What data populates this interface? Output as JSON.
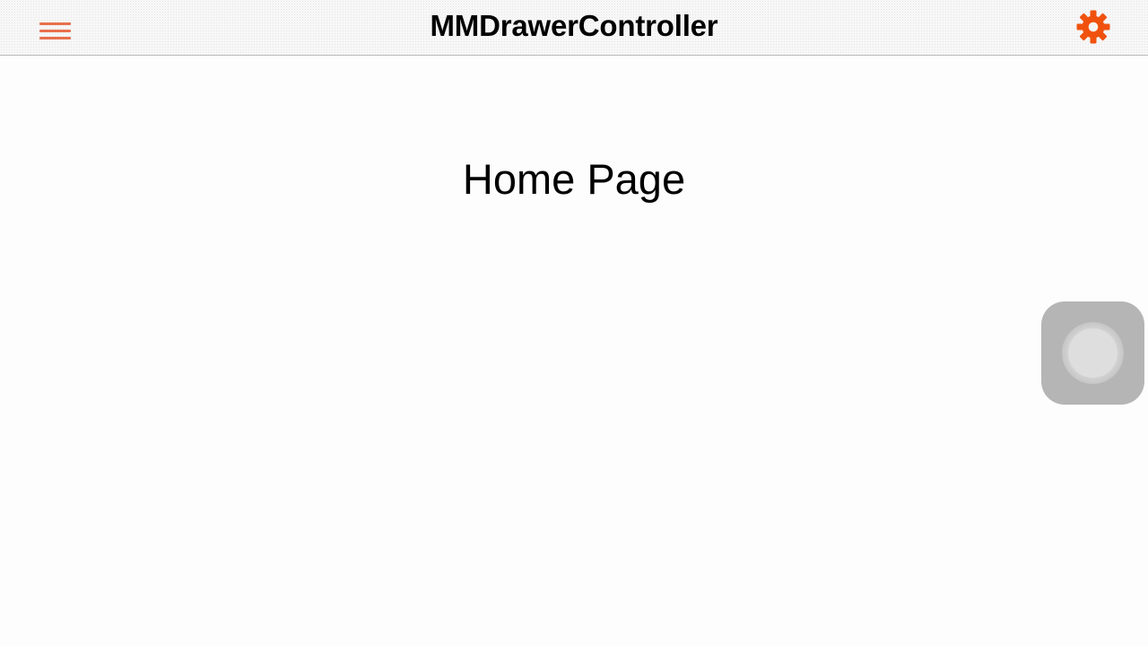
{
  "navbar": {
    "title": "MMDrawerController",
    "left_button_icon": "hamburger-menu-icon",
    "right_button_icon": "gear-icon",
    "tint_color": "#e8704d",
    "gear_color": "#f0520e"
  },
  "main": {
    "page_label": "Home Page"
  },
  "overlay": {
    "assistive_touch_icon": "assistive-touch-icon"
  }
}
